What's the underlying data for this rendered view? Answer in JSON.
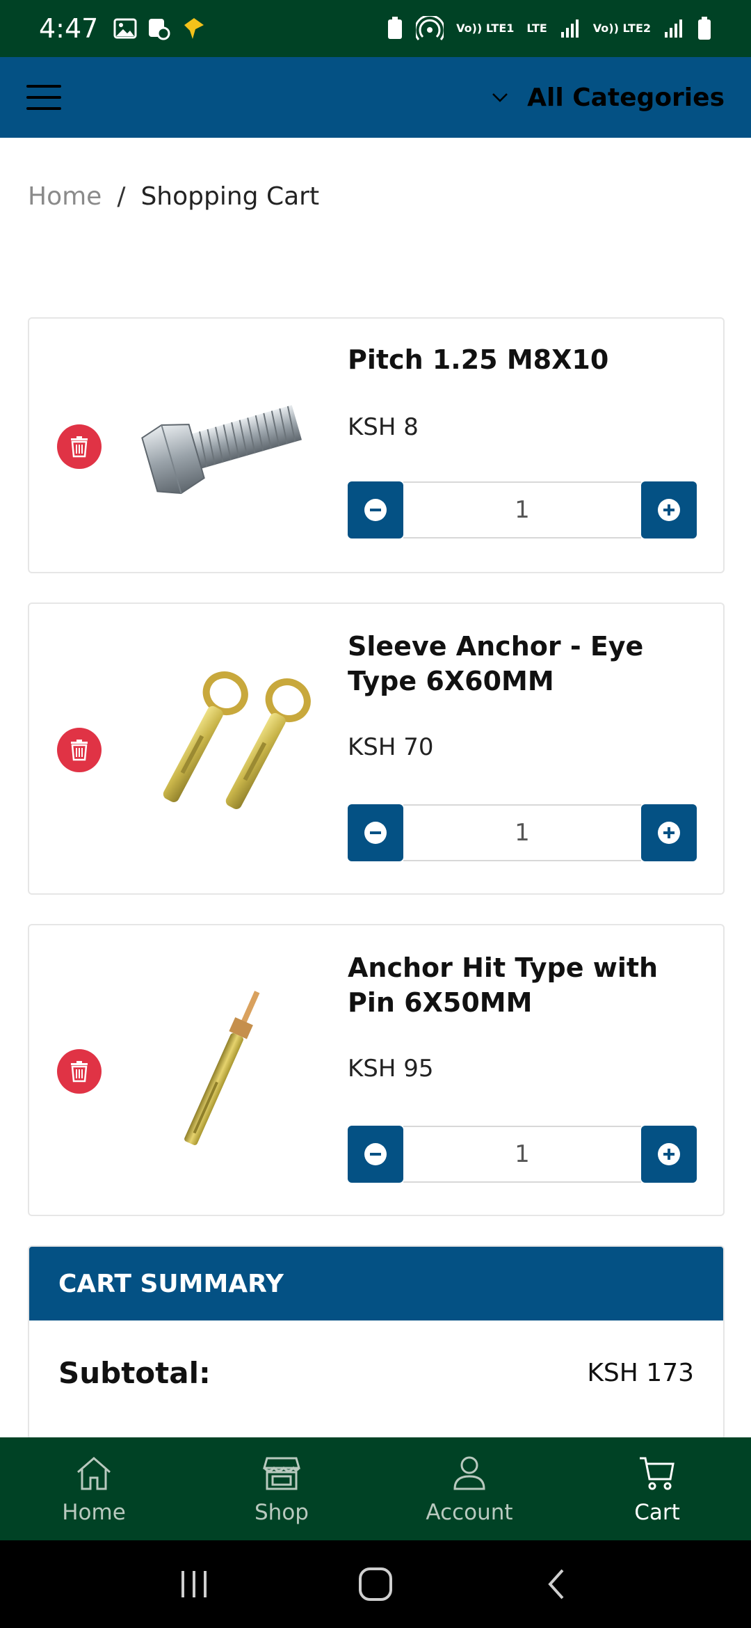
{
  "status_bar": {
    "time": "4:47",
    "sim1_label": "Vo)) LTE1",
    "sim2_label": "Vo)) LTE2",
    "lte_label": "LTE"
  },
  "header": {
    "categories_label": "All Categories"
  },
  "breadcrumb": {
    "home": "Home",
    "separator": "/",
    "current": "Shopping Cart"
  },
  "cart": {
    "items": [
      {
        "name": "Pitch 1.25 M8X10",
        "price": "KSH 8",
        "quantity": "1"
      },
      {
        "name": "Sleeve Anchor - Eye Type 6X60MM",
        "price": "KSH 70",
        "quantity": "1"
      },
      {
        "name": "Anchor Hit Type with Pin 6X50MM",
        "price": "KSH 95",
        "quantity": "1"
      }
    ]
  },
  "summary": {
    "title": "CART SUMMARY",
    "subtotal_label": "Subtotal:",
    "subtotal_value": "KSH 173"
  },
  "bottom_nav": {
    "items": [
      {
        "label": "Home",
        "icon": "home-icon",
        "active": false
      },
      {
        "label": "Shop",
        "icon": "shop-icon",
        "active": false
      },
      {
        "label": "Account",
        "icon": "account-icon",
        "active": false
      },
      {
        "label": "Cart",
        "icon": "cart-icon",
        "active": true
      }
    ]
  },
  "colors": {
    "status_bar": "#004225",
    "header": "#045184",
    "delete": "#e03345",
    "bottom_nav": "#004225"
  }
}
